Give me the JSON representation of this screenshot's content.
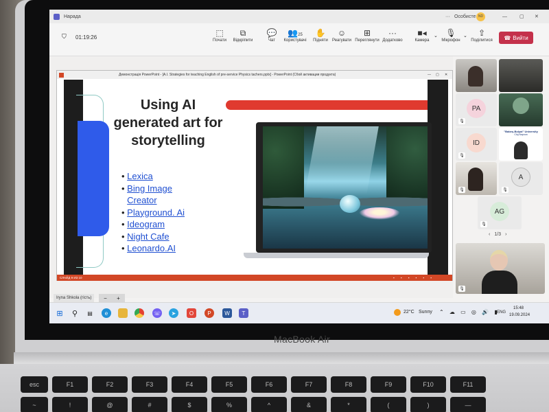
{
  "laptop": {
    "brand": "MacBook Air"
  },
  "teams": {
    "window_title": "Нарада",
    "profile_label": "Особисте",
    "profile_initials": "ND",
    "timer": "01:19:26",
    "toolbar": [
      {
        "label": "Почати",
        "icon": "record-icon"
      },
      {
        "label": "Відкріпити",
        "icon": "unpin-icon"
      },
      {
        "label": "Чат",
        "icon": "chat-icon"
      },
      {
        "label": "Користувачі",
        "icon": "people-icon",
        "count": "25"
      },
      {
        "label": "Підняти",
        "icon": "raise-hand-icon"
      },
      {
        "label": "Реагувати",
        "icon": "react-icon"
      },
      {
        "label": "Переглянути",
        "icon": "view-icon"
      },
      {
        "label": "Додатково",
        "icon": "more-icon"
      },
      {
        "label": "Камера",
        "icon": "camera-icon"
      },
      {
        "label": "Мікрофон",
        "icon": "microphone-icon"
      },
      {
        "label": "Поділитися",
        "icon": "share-icon"
      }
    ],
    "leave_label": "Вийти",
    "presenter_label": "Iryna Shkola (гість)",
    "zoom_minus": "−",
    "zoom_plus": "+"
  },
  "powerpoint": {
    "title": "Демонстрація PowerPoint - [A.I. Strategies for teaching English of pre-service Physics tachers.pptx] - PowerPoint (Сбой активации продукта)",
    "status_left": "СЛАЙД 9 ИЗ 10",
    "slide": {
      "title": "Using AI generated art for storytelling",
      "links": [
        "Lexica",
        "Bing Image Creator",
        "Playground. Ai",
        "Ideogram",
        "Night Cafe",
        "Leonardo.AI"
      ]
    }
  },
  "participants": {
    "tiles": [
      {
        "initials": "PA",
        "color": "#f5d3dc"
      },
      {
        "initials": "ID",
        "color": "#f8d9cf"
      },
      {
        "initials": "A",
        "color": "#e3e3e3"
      },
      {
        "initials": "AG",
        "color": "#d7ecd9"
      }
    ],
    "university_text": "\"Babeş-Bolyai\" University",
    "university_city": "Cluj-Napoca",
    "pager": "1/3"
  },
  "taskbar": {
    "weather_temp": "22°C",
    "weather_text": "Sunny",
    "language": "ENG",
    "time": "15:48",
    "date": "19.09.2024"
  },
  "keyboard": {
    "row1": [
      "esc",
      "F1",
      "F2",
      "F3",
      "F4",
      "F5",
      "F6",
      "F7",
      "F8",
      "F9",
      "F10",
      "F11"
    ],
    "row2": [
      "~",
      "!",
      "@",
      "#",
      "$",
      "%",
      "^",
      "&",
      "*",
      "(",
      ")",
      "—"
    ]
  },
  "colors": {
    "accent_red": "#e03a2f",
    "slide_blue": "#2f5bea",
    "teams_leave": "#c4314b"
  }
}
